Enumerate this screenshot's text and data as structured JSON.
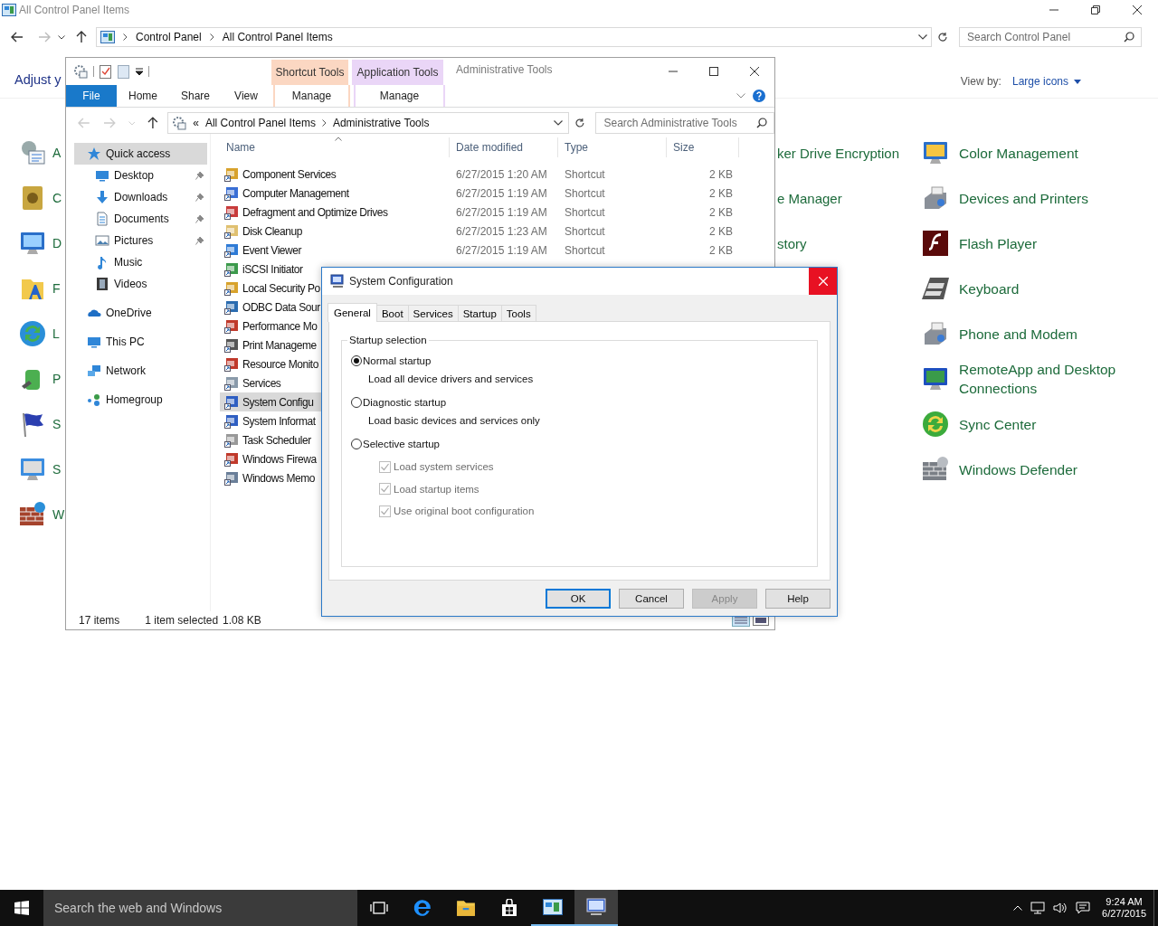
{
  "control_panel": {
    "title": "All Control Panel Items",
    "breadcrumb": [
      "Control Panel",
      "All Control Panel Items"
    ],
    "search": {
      "placeholder": "Search Control Panel"
    },
    "heading": "Adjust y",
    "view_by": {
      "label": "View by:",
      "value": "Large icons"
    },
    "items_left": [
      {
        "label": "A"
      },
      {
        "label": "C"
      },
      {
        "label": "D"
      },
      {
        "label": "F"
      },
      {
        "label": "L"
      },
      {
        "label": "P"
      },
      {
        "label": "S"
      },
      {
        "label": "S"
      },
      {
        "label": "W"
      }
    ],
    "items_middle": [
      {
        "label": "ker Drive Encryption"
      },
      {
        "label": "e Manager"
      },
      {
        "label": "story"
      }
    ],
    "items_right": [
      {
        "label": "Color Management"
      },
      {
        "label": "Devices and Printers"
      },
      {
        "label": "Flash Player"
      },
      {
        "label": "Keyboard"
      },
      {
        "label": "Phone and Modem"
      },
      {
        "label": "RemoteApp and Desktop Connections"
      },
      {
        "label": "Sync Center"
      },
      {
        "label": "Windows Defender"
      }
    ]
  },
  "explorer": {
    "title": "Administrative Tools",
    "context_tabs": [
      {
        "group": "Shortcut Tools",
        "label": "Manage",
        "color": "#fbd7c2"
      },
      {
        "group": "Application Tools",
        "label": "Manage",
        "color": "#ead6f7"
      }
    ],
    "ribbon_tabs": [
      {
        "label": "File",
        "selected": true
      },
      {
        "label": "Home",
        "selected": false
      },
      {
        "label": "Share",
        "selected": false
      },
      {
        "label": "View",
        "selected": false
      }
    ],
    "address": {
      "overflow": "«",
      "breadcrumb": [
        "All Control Panel Items",
        "Administrative Tools"
      ]
    },
    "search": {
      "placeholder": "Search Administrative Tools"
    },
    "nav": [
      {
        "label": "Quick access",
        "selected": true,
        "children": [
          {
            "label": "Desktop",
            "pinned": true
          },
          {
            "label": "Downloads",
            "pinned": true
          },
          {
            "label": "Documents",
            "pinned": true
          },
          {
            "label": "Pictures",
            "pinned": true
          },
          {
            "label": "Music",
            "pinned": false
          },
          {
            "label": "Videos",
            "pinned": false
          }
        ]
      },
      {
        "label": "OneDrive",
        "selected": false
      },
      {
        "label": "This PC",
        "selected": false
      },
      {
        "label": "Network",
        "selected": false
      },
      {
        "label": "Homegroup",
        "selected": false
      }
    ],
    "columns": [
      "Name",
      "Date modified",
      "Type",
      "Size"
    ],
    "files": [
      {
        "name": "Component Services",
        "date": "6/27/2015 1:20 AM",
        "type": "Shortcut",
        "size": "2 KB",
        "selected": false
      },
      {
        "name": "Computer Management",
        "date": "6/27/2015 1:19 AM",
        "type": "Shortcut",
        "size": "2 KB",
        "selected": false
      },
      {
        "name": "Defragment and Optimize Drives",
        "date": "6/27/2015 1:19 AM",
        "type": "Shortcut",
        "size": "2 KB",
        "selected": false
      },
      {
        "name": "Disk Cleanup",
        "date": "6/27/2015 1:23 AM",
        "type": "Shortcut",
        "size": "2 KB",
        "selected": false
      },
      {
        "name": "Event Viewer",
        "date": "6/27/2015 1:19 AM",
        "type": "Shortcut",
        "size": "2 KB",
        "selected": false
      },
      {
        "name": "iSCSI Initiator",
        "selected": false
      },
      {
        "name": "Local Security Po",
        "selected": false
      },
      {
        "name": "ODBC Data Sour",
        "selected": false
      },
      {
        "name": "Performance Mo",
        "selected": false
      },
      {
        "name": "Print Manageme",
        "selected": false
      },
      {
        "name": "Resource Monito",
        "selected": false
      },
      {
        "name": "Services",
        "selected": false
      },
      {
        "name": "System Configu",
        "selected": true
      },
      {
        "name": "System Informat",
        "selected": false
      },
      {
        "name": "Task Scheduler",
        "selected": false
      },
      {
        "name": "Windows Firewa",
        "selected": false
      },
      {
        "name": "Windows Memo",
        "selected": false
      }
    ],
    "status": {
      "count": "17 items",
      "selection": "1 item selected",
      "size": "1.08 KB"
    }
  },
  "dialog": {
    "title": "System Configuration",
    "tabs": [
      {
        "label": "General",
        "selected": true
      },
      {
        "label": "Boot",
        "selected": false
      },
      {
        "label": "Services",
        "selected": false
      },
      {
        "label": "Startup",
        "selected": false
      },
      {
        "label": "Tools",
        "selected": false
      }
    ],
    "group": "Startup selection",
    "options": [
      {
        "label": "Normal startup",
        "description": "Load all device drivers and services",
        "selected": true
      },
      {
        "label": "Diagnostic startup",
        "description": "Load basic devices and services only",
        "selected": false
      },
      {
        "label": "Selective startup",
        "selected": false,
        "checkboxes": [
          {
            "label": "Load system services",
            "checked": true,
            "disabled": true
          },
          {
            "label": "Load startup items",
            "checked": true,
            "disabled": true
          },
          {
            "label": "Use original boot configuration",
            "checked": true,
            "disabled": true
          }
        ]
      }
    ],
    "buttons": [
      {
        "label": "OK",
        "default": true,
        "disabled": false
      },
      {
        "label": "Cancel",
        "default": false,
        "disabled": false
      },
      {
        "label": "Apply",
        "default": false,
        "disabled": true
      },
      {
        "label": "Help",
        "default": false,
        "disabled": false
      }
    ]
  },
  "taskbar": {
    "search": {
      "placeholder": "Search the web and Windows"
    },
    "apps": [
      {
        "kind": "taskview",
        "running": false,
        "selected": false
      },
      {
        "kind": "edge",
        "running": false,
        "selected": false
      },
      {
        "kind": "explorer",
        "running": false,
        "selected": false
      },
      {
        "kind": "store",
        "running": false,
        "selected": false
      },
      {
        "kind": "controlpanel",
        "running": true,
        "selected": false
      },
      {
        "kind": "msconfig",
        "running": true,
        "selected": true
      }
    ],
    "time": "9:24 AM",
    "date": "6/27/2015"
  }
}
